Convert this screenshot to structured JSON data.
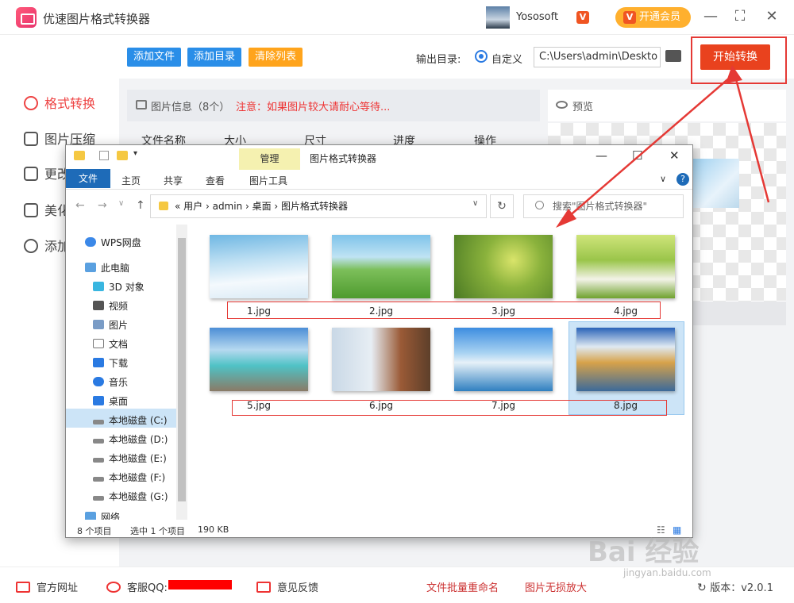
{
  "app": {
    "title": "优速图片格式转换器",
    "user": "Yososoft",
    "vip": "开通会员"
  },
  "sidebar": {
    "items": [
      {
        "label": "格式转换"
      },
      {
        "label": "图片压缩"
      },
      {
        "label": "更改"
      },
      {
        "label": "美化"
      },
      {
        "label": "添加"
      }
    ]
  },
  "toolbar": {
    "add_file": "添加文件",
    "add_dir": "添加目录",
    "clear": "清除列表",
    "output_label": "输出目录:",
    "custom": "自定义",
    "path": "C:\\Users\\admin\\Deskto",
    "start": "开始转换"
  },
  "info": {
    "title": "图片信息（8个）",
    "note": "注意：如果图片较大请耐心等待..."
  },
  "table": {
    "headers": [
      "文件名称",
      "大小",
      "尺寸",
      "进度",
      "操作"
    ]
  },
  "preview": {
    "label": "预览"
  },
  "explorer": {
    "title": "图片格式转换器",
    "manage": "管理",
    "tabs": [
      "文件",
      "主页",
      "共享",
      "查看",
      "图片工具"
    ],
    "address": "«  用户  ›  admin  ›  桌面  ›  图片格式转换器",
    "search_placeholder": "搜索\"图片格式转换器\"",
    "tree": [
      "WPS网盘",
      "此电脑",
      "3D 对象",
      "视频",
      "图片",
      "文档",
      "下载",
      "音乐",
      "桌面",
      "本地磁盘 (C:)",
      "本地磁盘 (D:)",
      "本地磁盘 (E:)",
      "本地磁盘 (F:)",
      "本地磁盘 (G:)",
      "网络"
    ],
    "files": [
      "1.jpg",
      "2.jpg",
      "3.jpg",
      "4.jpg",
      "5.jpg",
      "6.jpg",
      "7.jpg",
      "8.jpg"
    ],
    "status": {
      "count": "8 个项目",
      "selected": "选中 1 个项目",
      "size": "190 KB"
    }
  },
  "footer": {
    "site": "官方网址",
    "qq": "客服QQ:",
    "feedback": "意见反馈",
    "rename": "文件批量重命名",
    "enlarge": "图片无损放大",
    "version": "版本：v2.0.1"
  },
  "watermark": {
    "brand": "Bai 经验",
    "url": "jingyan.baidu.com"
  },
  "colors": {
    "accent": "#e9421e",
    "blue_btn": "#2a8ee8",
    "orange_btn": "#ffa41c",
    "note": "#e33333"
  }
}
